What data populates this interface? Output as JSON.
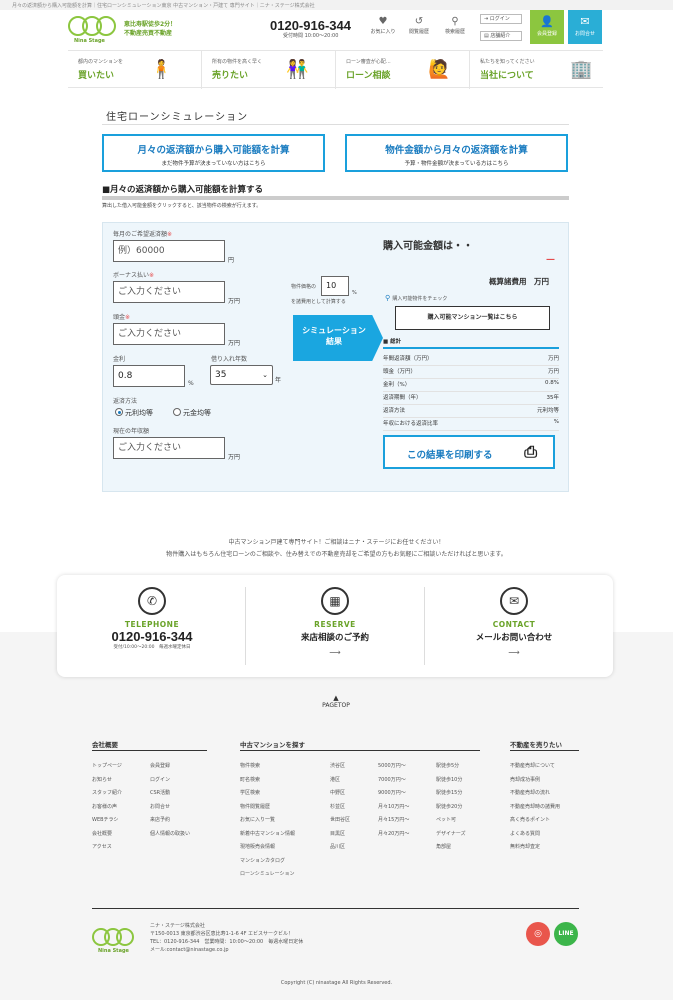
{
  "topstrip": {
    "text": "月々の返済額から購入可能額を計算｜住宅ローンシミュレーション東京 中古マンション・戸建て 専門サイト｜ニナ・ステージ株式会社"
  },
  "header": {
    "logo_text": "Nina Stage",
    "tagline_1": "恵比寿駅徒歩2分！",
    "tagline_2": "不動産売買不動産",
    "phone": "0120-916-344",
    "hours": "受付時間 10:00〜20:00",
    "icons": [
      {
        "label": "お気に入り",
        "glyph": "♥"
      },
      {
        "label": "閲覧履歴",
        "glyph": "↺"
      },
      {
        "label": "検索履歴",
        "glyph": "⚲"
      }
    ],
    "login_label": "ログイン",
    "lang_label": "店舗紹介",
    "member_label": "会員登録",
    "contact_label": "お問合せ",
    "member_color": "#8cc63f",
    "contact_color": "#2aaed6"
  },
  "nav": [
    {
      "sub": "都内のマンションを",
      "main": "買いたい",
      "pic": "🧍"
    },
    {
      "sub": "所有の物件を高く早く",
      "main": "売りたい",
      "pic": "👫"
    },
    {
      "sub": "ローン審査が心配…",
      "main": "ローン相談",
      "pic": "🙋"
    },
    {
      "sub": "私たちを知ってください",
      "main": "当社について",
      "pic": "🏢"
    }
  ],
  "page": {
    "title": "住宅ローンシミュレーション",
    "tab1_title": "月々の返済額から購入可能額を計算",
    "tab1_sub": "まだ物件予算が決まっていない方はこちら",
    "tab2_title": "物件金額から月々の返済額を計算",
    "tab2_sub": "予算・物件金額が決まっている方はこちら",
    "section_heading": "■月々の返済額から購入可能額を計算する",
    "note": "算出した借入可能金額をクリックすると、該当物件の検索が行えます。"
  },
  "form": {
    "monthly_label": "毎月のご希望返済額",
    "monthly_placeholder": "例）60000",
    "monthly_unit": "円",
    "bonus_label": "ボーナス払い",
    "bonus_placeholder": "ご入力ください",
    "bonus_unit": "万円",
    "down_label": "頭金",
    "down_placeholder": "ご入力ください",
    "down_unit": "万円",
    "rate_label": "金利",
    "rate_value": "0.8",
    "rate_unit": "%",
    "years_label": "借り入れ年数",
    "years_value": "35",
    "years_unit": "年",
    "method_label": "返済方法",
    "method_opt1": "元利均等",
    "method_opt2": "元金均等",
    "income_label": "現在の年収額",
    "income_placeholder": "ご入力ください",
    "income_unit": "万円",
    "req_mark": "※",
    "cost_prefix": "物件価格の",
    "cost_value": "10",
    "cost_pct": "%",
    "cost_suffix": "を諸費用として計算する",
    "sim_button_1": "シミュレーション",
    "sim_button_2": "結果"
  },
  "result": {
    "title": "購入可能金額は・・",
    "dash": "—",
    "cost_line": "概算諸費用　万円",
    "check_label": "購入可能物件をチェック",
    "list_button": "購入可能マンション一覧はこちら",
    "summary_head": "■ 総計",
    "rows": [
      {
        "k": "年間返済額（万円）",
        "v": "万円"
      },
      {
        "k": "頭金（万円）",
        "v": "万円"
      },
      {
        "k": "金利（%）",
        "v": "0.8%"
      },
      {
        "k": "返済期間（年）",
        "v": "35年"
      },
      {
        "k": "返済方法",
        "v": "元利均等"
      },
      {
        "k": "年収における返済比率",
        "v": "%"
      }
    ],
    "print_label": "この結果を印刷する"
  },
  "intro": {
    "line1": "中古マンション戸建て専門サイト！ご相談はニナ・ステージにお任せください！",
    "line2": "物件購入はもちろん住宅ローンのご相談や、住み替えでの不動産売却をご希望の方もお気軽にご相談いただければと思います。"
  },
  "contact": {
    "tel_head": "TELEPHONE",
    "tel_number": "0120-916-344",
    "tel_hours": "受付/10:00〜20:00　毎週水曜定休日",
    "res_head": "RESERVE",
    "res_text": "来店相談のご予約",
    "mail_head": "CONTACT",
    "mail_text": "メールお問い合わせ"
  },
  "pagetop": "PAGETOP",
  "footer": {
    "col1_head": "会社概要",
    "col1_a": [
      "トップページ",
      "お知らせ",
      "スタッフ紹介",
      "お客様の声",
      "WEBチラシ",
      "会社概要",
      "アクセス"
    ],
    "col1_b": [
      "会員登録",
      "ログイン",
      "CSR活動",
      "お問合せ",
      "来店予約",
      "個人情報の取扱い"
    ],
    "col2_head": "中古マンションを探す",
    "col2_a": [
      "物件検索",
      "町名検索",
      "学区検索",
      "物件閲覧履歴",
      "お気に入り一覧",
      "新着中古マンション情報",
      "現地販売会情報",
      "マンションカタログ",
      "ローンシミュレーション"
    ],
    "col2_b": [
      "渋谷区",
      "港区",
      "中野区",
      "杉並区",
      "世田谷区",
      "目黒区",
      "品川区"
    ],
    "col2_c": [
      "5000万円〜",
      "7000万円〜",
      "9000万円〜",
      "月々10万円〜",
      "月々15万円〜",
      "月々20万円〜"
    ],
    "col2_d": [
      "駅徒歩5分",
      "駅徒歩10分",
      "駅徒歩15分",
      "駅徒歩20分",
      "ペット可",
      "デザイナーズ",
      "角部屋"
    ],
    "col3_head": "不動産を売りたい",
    "col3_a": [
      "不動産売却について",
      "売却成功事例",
      "不動産売却の流れ",
      "不動産売却時の諸費用",
      "高く売るポイント",
      "よくある質問",
      "無料売却査定"
    ],
    "company_name": "ニナ・ステージ株式会社",
    "address": "〒150-0013 東京都渋谷区恵比寿1-1-6 4F エビスサークビル！",
    "phone_line": "TEL：0120-916-344　営業時間：10:00〜20:00　毎週水曜日定休",
    "mail_line": "メール:contact@ninastage.co.jp",
    "logo_text": "Nina Stage",
    "instagram_color": "#e9564c",
    "line_color": "#3cb54a",
    "copyright": "Copyright (C) ninastage All Rights Reserved."
  }
}
